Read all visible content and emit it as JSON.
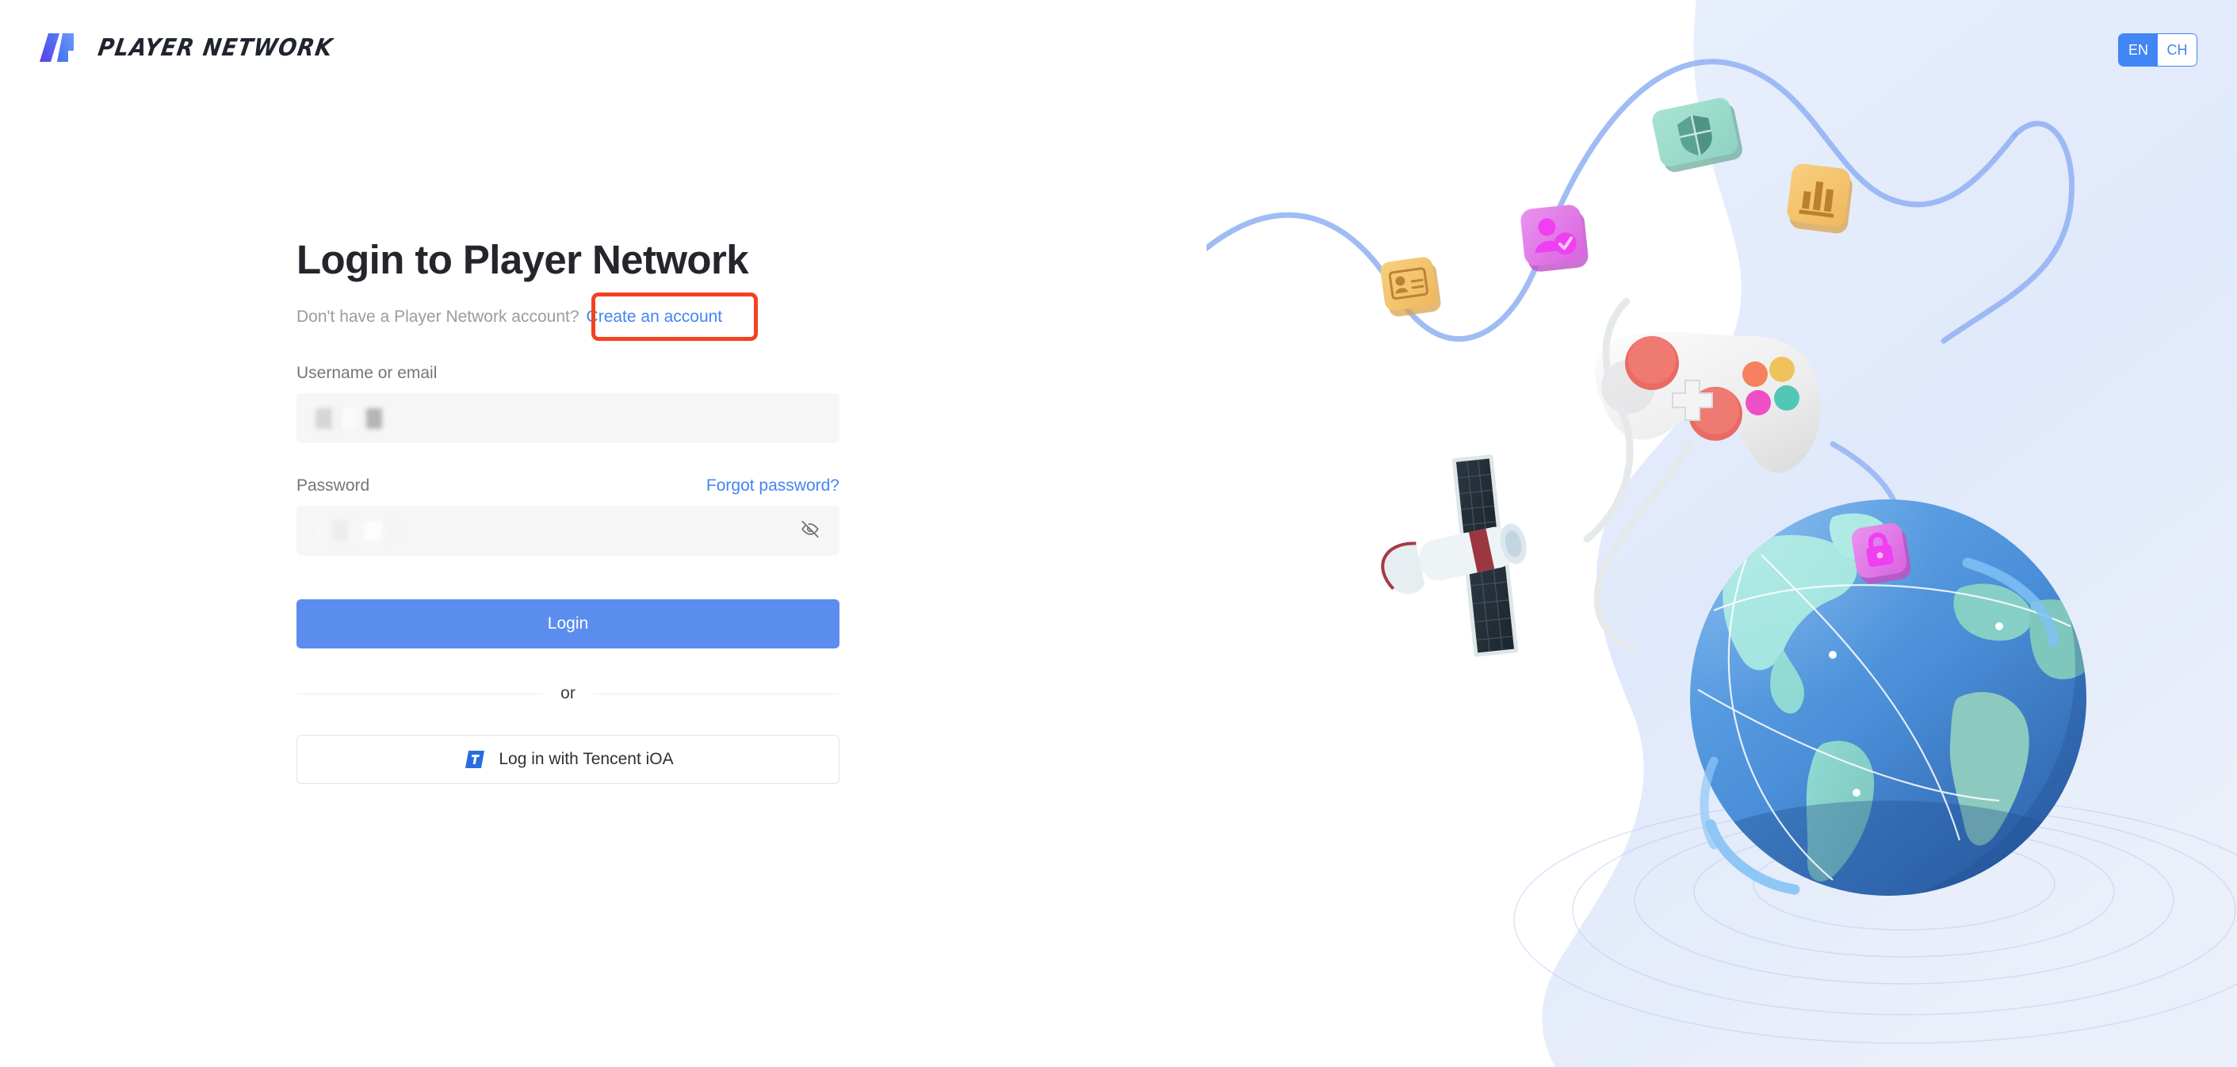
{
  "brand": {
    "name": "PLAYER NETWORK",
    "logo_icon": "player-network-logo-icon",
    "logo_colors": [
      "#5b5cf0",
      "#4f7df7"
    ]
  },
  "language_toggle": {
    "options": [
      {
        "code": "EN",
        "label": "EN",
        "active": true
      },
      {
        "code": "CH",
        "label": "CH",
        "active": false
      }
    ],
    "active_color": "#4285f4"
  },
  "login": {
    "title": "Login to Player Network",
    "signup_prompt": "Don't have a Player Network account?",
    "signup_link": "Create an account",
    "username": {
      "label": "Username or email",
      "value": "",
      "placeholder": "",
      "redacted": true
    },
    "password": {
      "label": "Password",
      "forgot_link": "Forgot password?",
      "value": "",
      "placeholder": "",
      "redacted": true,
      "visibility_icon": "eye-off-icon",
      "visible": false
    },
    "submit_label": "Login",
    "divider_label": "or",
    "sso_label": "Log in with Tencent iOA",
    "sso_icon": "tencent-ioa-icon",
    "button_color": "#5b8def",
    "link_color": "#4285f4"
  },
  "annotation": {
    "target": "Create an account",
    "color": "#f4411e",
    "shape": "rounded-rectangle"
  },
  "illustration": {
    "name": "network-security-gaming-illustration",
    "background_color": "#e4ecfb",
    "elements": [
      {
        "name": "shield-card-icon",
        "color": "#9bd9c8"
      },
      {
        "name": "bar-chart-card-icon",
        "color": "#f5c46a"
      },
      {
        "name": "verified-user-card-icon",
        "color": "#e07ae8"
      },
      {
        "name": "id-card-icon",
        "color": "#f2c774"
      },
      {
        "name": "lock-card-icon",
        "color": "#e86ad8"
      },
      {
        "name": "game-controller-icon",
        "color": "#efefef"
      },
      {
        "name": "satellite-icon",
        "color": "#e6edf2"
      },
      {
        "name": "globe-icon",
        "color": "#4a8fd8"
      },
      {
        "name": "connection-curve",
        "color": "#87a9f0"
      }
    ]
  }
}
